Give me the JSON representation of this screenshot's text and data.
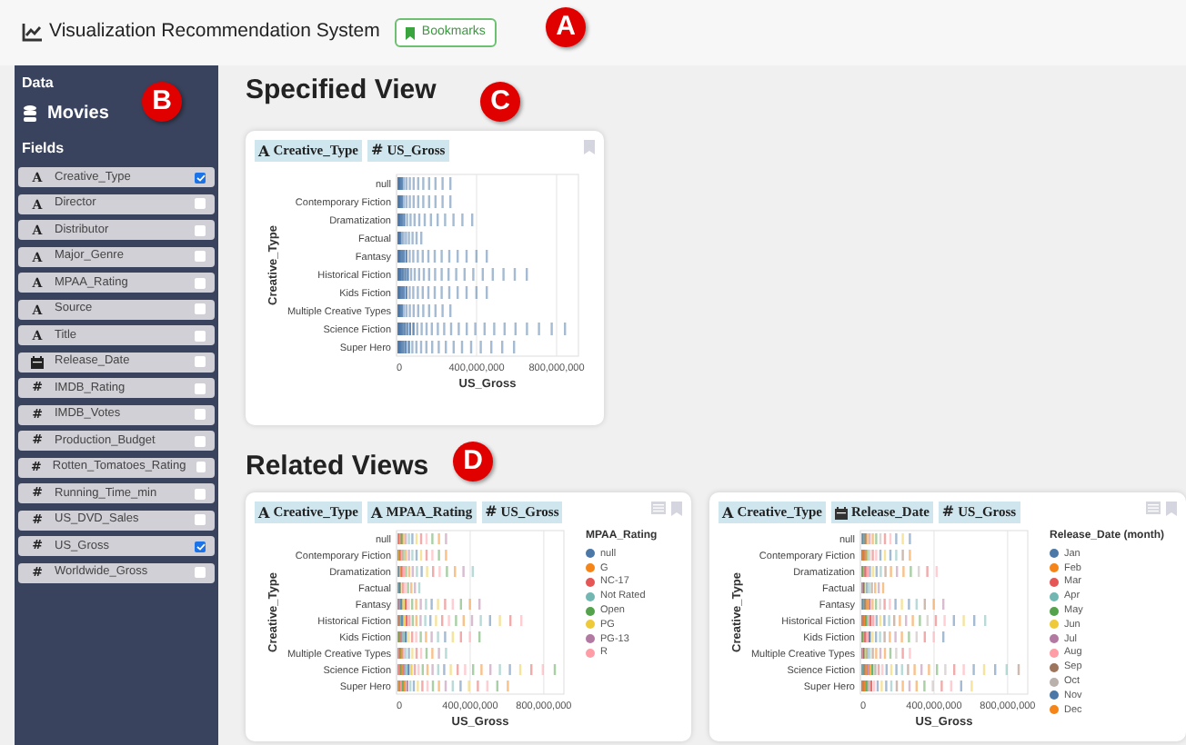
{
  "header": {
    "title": "Visualization Recommendation System",
    "bookmarks_button": "Bookmarks"
  },
  "sidebar": {
    "data_label": "Data",
    "dataset": "Movies",
    "fields_label": "Fields",
    "fields": [
      {
        "name": "Creative_Type",
        "kind": "nominal",
        "icon": "A",
        "checked": true
      },
      {
        "name": "Director",
        "kind": "nominal",
        "icon": "A",
        "checked": false
      },
      {
        "name": "Distributor",
        "kind": "nominal",
        "icon": "A",
        "checked": false
      },
      {
        "name": "Major_Genre",
        "kind": "nominal",
        "icon": "A",
        "checked": false
      },
      {
        "name": "MPAA_Rating",
        "kind": "nominal",
        "icon": "A",
        "checked": false
      },
      {
        "name": "Source",
        "kind": "nominal",
        "icon": "A",
        "checked": false
      },
      {
        "name": "Title",
        "kind": "nominal",
        "icon": "A",
        "checked": false
      },
      {
        "name": "Release_Date",
        "kind": "temporal",
        "checked": false
      },
      {
        "name": "IMDB_Rating",
        "kind": "quantitative",
        "icon": "#",
        "checked": false
      },
      {
        "name": "IMDB_Votes",
        "kind": "quantitative",
        "icon": "#",
        "checked": false
      },
      {
        "name": "Production_Budget",
        "kind": "quantitative",
        "icon": "#",
        "checked": false
      },
      {
        "name": "Rotten_Tomatoes_Rating",
        "kind": "quantitative",
        "icon": "#",
        "checked": false
      },
      {
        "name": "Running_Time_min",
        "kind": "quantitative",
        "icon": "#",
        "checked": false
      },
      {
        "name": "US_DVD_Sales",
        "kind": "quantitative",
        "icon": "#",
        "checked": false
      },
      {
        "name": "US_Gross",
        "kind": "quantitative",
        "icon": "#",
        "checked": true
      },
      {
        "name": "Worldwide_Gross",
        "kind": "quantitative",
        "icon": "#",
        "checked": false
      }
    ]
  },
  "specified_view": {
    "heading": "Specified View",
    "card": {
      "encodings": [
        {
          "kind": "nominal",
          "icon": "A",
          "name": "Creative_Type"
        },
        {
          "kind": "quantitative",
          "icon": "#",
          "name": "US_Gross"
        }
      ],
      "chart": {
        "ylabel": "Creative_Type",
        "xlabel": "US_Gross",
        "xticks": [
          "0",
          "400,000,000",
          "800,000,000"
        ],
        "categories": [
          {
            "label": "null",
            "level": 0.3
          },
          {
            "label": "Contemporary Fiction",
            "level": 0.3
          },
          {
            "label": "Dramatization",
            "level": 0.42
          },
          {
            "label": "Factual",
            "level": 0.14
          },
          {
            "label": "Fantasy",
            "level": 0.5
          },
          {
            "label": "Historical Fiction",
            "level": 0.72
          },
          {
            "label": "Kids Fiction",
            "level": 0.5
          },
          {
            "label": "Multiple Creative Types",
            "level": 0.3
          },
          {
            "label": "Science Fiction",
            "level": 0.93
          },
          {
            "label": "Super Hero",
            "level": 0.65
          }
        ]
      }
    }
  },
  "related_views": {
    "heading": "Related Views",
    "cards": [
      {
        "encodings": [
          {
            "kind": "nominal",
            "icon": "A",
            "name": "Creative_Type"
          },
          {
            "kind": "nominal",
            "icon": "A",
            "name": "MPAA_Rating"
          },
          {
            "kind": "quantitative",
            "icon": "#",
            "name": "US_Gross"
          }
        ],
        "chart": {
          "ylabel": "Creative_Type",
          "xlabel": "US_Gross",
          "xticks": [
            "0",
            "400,000,000",
            "800,000,000"
          ],
          "categories": [
            {
              "label": "null",
              "level": 0.3
            },
            {
              "label": "Contemporary Fiction",
              "level": 0.3
            },
            {
              "label": "Dramatization",
              "level": 0.46
            },
            {
              "label": "Factual",
              "level": 0.14
            },
            {
              "label": "Fantasy",
              "level": 0.5
            },
            {
              "label": "Historical Fiction",
              "level": 0.75
            },
            {
              "label": "Kids Fiction",
              "level": 0.5
            },
            {
              "label": "Multiple Creative Types",
              "level": 0.3
            },
            {
              "label": "Science Fiction",
              "level": 0.95
            },
            {
              "label": "Super Hero",
              "level": 0.67
            }
          ],
          "legend": {
            "title": "MPAA_Rating",
            "items": [
              {
                "label": "null",
                "color": "#4c78a8"
              },
              {
                "label": "G",
                "color": "#f58518"
              },
              {
                "label": "NC-17",
                "color": "#e45756"
              },
              {
                "label": "Not Rated",
                "color": "#72b7b2"
              },
              {
                "label": "Open",
                "color": "#54a24b"
              },
              {
                "label": "PG",
                "color": "#eeca3b"
              },
              {
                "label": "PG-13",
                "color": "#b279a2"
              },
              {
                "label": "R",
                "color": "#ff9da6"
              }
            ]
          }
        }
      },
      {
        "encodings": [
          {
            "kind": "nominal",
            "icon": "A",
            "name": "Creative_Type"
          },
          {
            "kind": "temporal",
            "name": "Release_Date"
          },
          {
            "kind": "quantitative",
            "icon": "#",
            "name": "US_Gross"
          }
        ],
        "chart": {
          "ylabel": "Creative_Type",
          "xlabel": "US_Gross",
          "xticks": [
            "0",
            "400,000,000",
            "800,000,000"
          ],
          "categories": [
            {
              "label": "null",
              "level": 0.3
            },
            {
              "label": "Contemporary Fiction",
              "level": 0.3
            },
            {
              "label": "Dramatization",
              "level": 0.46
            },
            {
              "label": "Factual",
              "level": 0.14
            },
            {
              "label": "Fantasy",
              "level": 0.5
            },
            {
              "label": "Historical Fiction",
              "level": 0.75
            },
            {
              "label": "Kids Fiction",
              "level": 0.5
            },
            {
              "label": "Multiple Creative Types",
              "level": 0.3
            },
            {
              "label": "Science Fiction",
              "level": 0.95
            },
            {
              "label": "Super Hero",
              "level": 0.67
            }
          ],
          "legend": {
            "title": "Release_Date (month)",
            "items": [
              {
                "label": "Jan",
                "color": "#4c78a8"
              },
              {
                "label": "Feb",
                "color": "#f58518"
              },
              {
                "label": "Mar",
                "color": "#e45756"
              },
              {
                "label": "Apr",
                "color": "#72b7b2"
              },
              {
                "label": "May",
                "color": "#54a24b"
              },
              {
                "label": "Jun",
                "color": "#eeca3b"
              },
              {
                "label": "Jul",
                "color": "#b279a2"
              },
              {
                "label": "Aug",
                "color": "#ff9da6"
              },
              {
                "label": "Sep",
                "color": "#9d755d"
              },
              {
                "label": "Oct",
                "color": "#bab0ac"
              },
              {
                "label": "Nov",
                "color": "#4c78a8"
              },
              {
                "label": "Dec",
                "color": "#f58518"
              }
            ]
          }
        }
      }
    ]
  },
  "annotations": [
    {
      "label": "A"
    },
    {
      "label": "B"
    },
    {
      "label": "C"
    },
    {
      "label": "D"
    }
  ]
}
